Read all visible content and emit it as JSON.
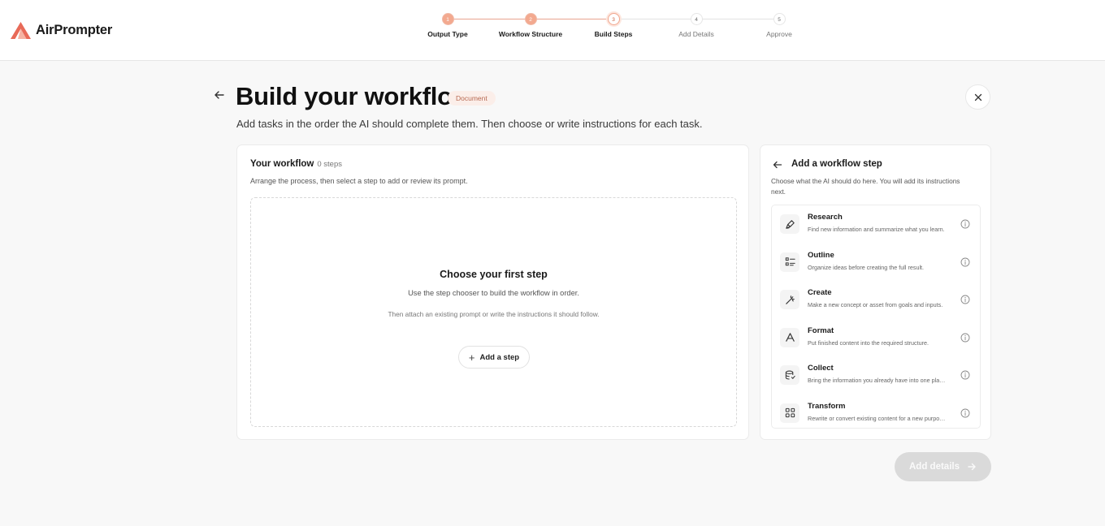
{
  "app": {
    "name": "AirPrompter"
  },
  "stepper": {
    "steps": [
      {
        "number": "1",
        "label": "Output Type"
      },
      {
        "number": "2",
        "label": "Workflow Structure"
      },
      {
        "number": "3",
        "label": "Build Steps"
      },
      {
        "number": "4",
        "label": "Add Details"
      },
      {
        "number": "5",
        "label": "Approve"
      }
    ]
  },
  "page": {
    "title": "Build your workflow",
    "badge": "Document",
    "subtitle": "Add tasks in the order the AI should complete them. Then choose or write instructions for each task."
  },
  "workflow": {
    "title": "Your workflow",
    "count": "0 steps",
    "subtitle": "Arrange the process, then select a step to add or review its prompt.",
    "empty_title": "Choose your first step",
    "empty_sub": "Use the step chooser to build the workflow in order.",
    "empty_sub2": "Then attach an existing prompt or write the instructions it should follow.",
    "add_step_label": "Add a step"
  },
  "chooser": {
    "title": "Add a workflow step",
    "subtitle": "Choose what the AI should do here. You will add its instructions next.",
    "items": [
      {
        "name": "Research",
        "desc": "Find new information and summarize what you learn.",
        "icon": "research-pen-icon"
      },
      {
        "name": "Outline",
        "desc": "Organize ideas before creating the full result.",
        "icon": "outline-list-icon"
      },
      {
        "name": "Create",
        "desc": "Make a new concept or asset from goals and inputs.",
        "icon": "create-wand-icon"
      },
      {
        "name": "Format",
        "desc": "Put finished content into the required structure.",
        "icon": "format-type-icon"
      },
      {
        "name": "Collect",
        "desc": "Bring the information you already have into one place.",
        "icon": "collect-database-icon"
      },
      {
        "name": "Transform",
        "desc": "Rewrite or convert existing content for a new purpose.",
        "icon": "transform-grid-icon"
      }
    ]
  },
  "footer": {
    "add_details_label": "Add details"
  },
  "colors": {
    "accent": "#f3a98f",
    "accent_text": "#c9603f",
    "logo": "#e05a4a"
  }
}
